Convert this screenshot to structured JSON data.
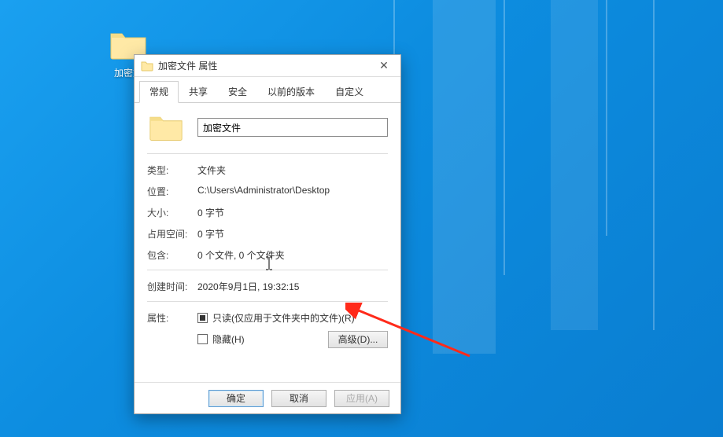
{
  "desktop": {
    "icon_label": "加密文"
  },
  "dialog": {
    "title": "加密文件 属性",
    "tabs": {
      "general": "常规",
      "share": "共享",
      "security": "安全",
      "previous": "以前的版本",
      "custom": "自定义"
    },
    "name_value": "加密文件",
    "rows": {
      "type_k": "类型:",
      "type_v": "文件夹",
      "loc_k": "位置:",
      "loc_v": "C:\\Users\\Administrator\\Desktop",
      "size_k": "大小:",
      "size_v": "0 字节",
      "disk_k": "占用空间:",
      "disk_v": "0 字节",
      "contains_k": "包含:",
      "contains_v": "0 个文件, 0 个文件夹",
      "created_k": "创建时间:",
      "created_v": "2020年9月1日, 19:32:15",
      "attr_k": "属性:",
      "readonly_label": "只读(仅应用于文件夹中的文件)(R)",
      "hidden_label": "隐藏(H)",
      "advanced_label": "高级(D)..."
    },
    "buttons": {
      "ok": "确定",
      "cancel": "取消",
      "apply": "应用(A)"
    }
  }
}
